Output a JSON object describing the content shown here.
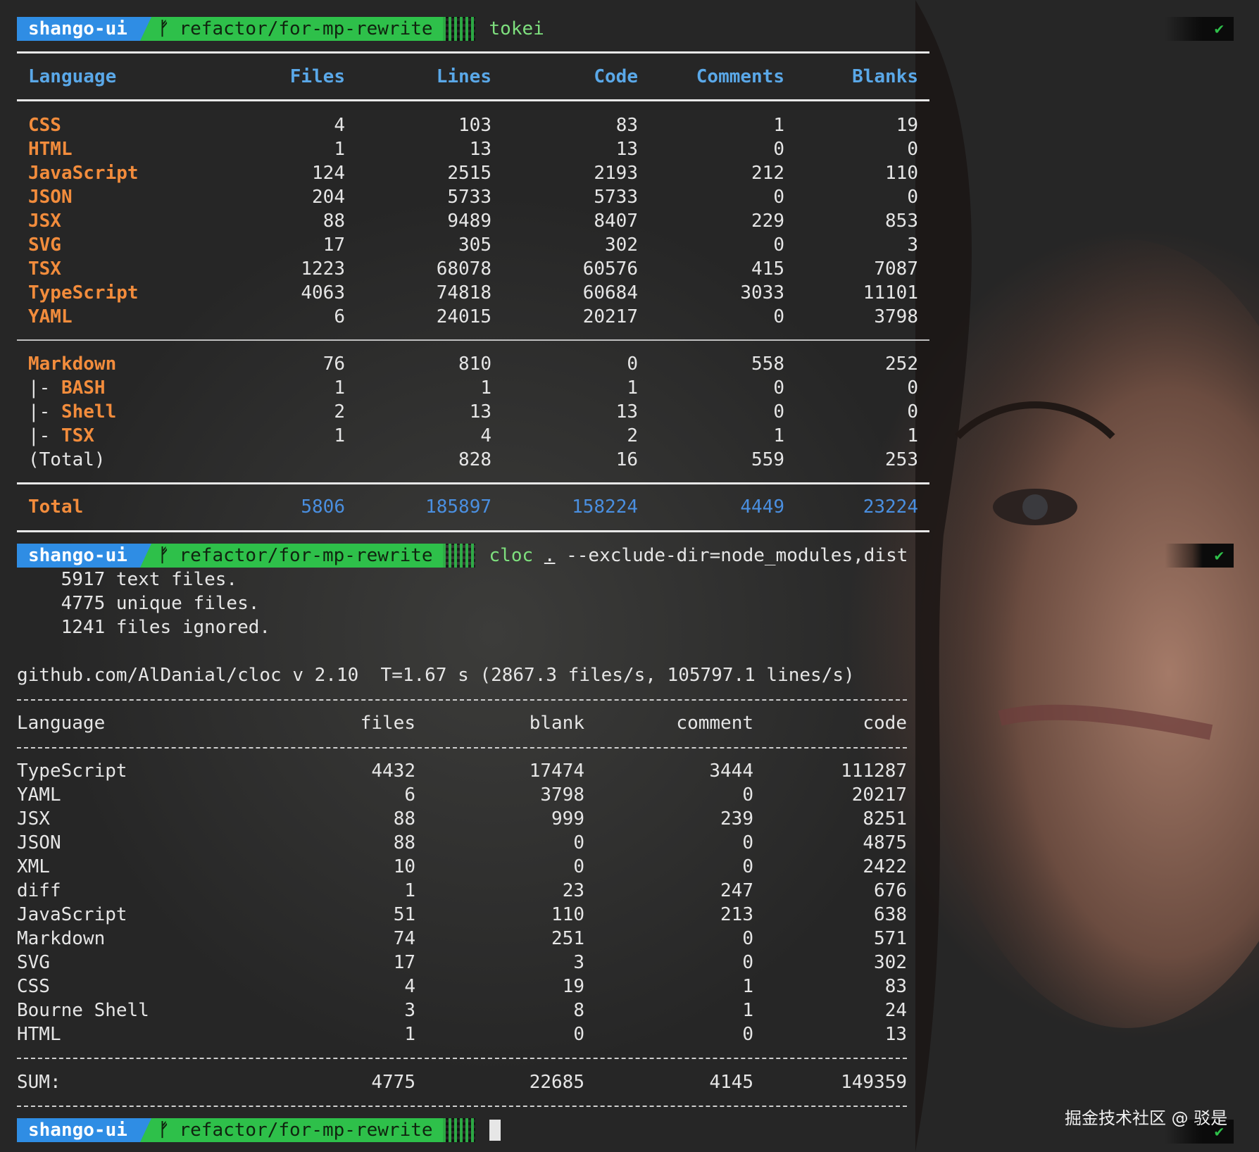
{
  "prompts": [
    {
      "user": "shango-ui",
      "git_icon": "ᚠ",
      "branch": "refactor/for-mp-rewrite",
      "command": "tokei",
      "args": "",
      "status": "✔"
    },
    {
      "user": "shango-ui",
      "git_icon": "ᚠ",
      "branch": "refactor/for-mp-rewrite",
      "command": "cloc",
      "dot": ".",
      "args": " --exclude-dir=node_modules,dist",
      "status": "✔"
    },
    {
      "user": "shango-ui",
      "git_icon": "ᚠ",
      "branch": "refactor/for-mp-rewrite",
      "command": "",
      "args": "",
      "status": "✔"
    }
  ],
  "tokei": {
    "headers": [
      "Language",
      "Files",
      "Lines",
      "Code",
      "Comments",
      "Blanks"
    ],
    "rows": [
      {
        "lang": "CSS",
        "files": "4",
        "lines": "103",
        "code": "83",
        "comments": "1",
        "blanks": "19"
      },
      {
        "lang": "HTML",
        "files": "1",
        "lines": "13",
        "code": "13",
        "comments": "0",
        "blanks": "0"
      },
      {
        "lang": "JavaScript",
        "files": "124",
        "lines": "2515",
        "code": "2193",
        "comments": "212",
        "blanks": "110"
      },
      {
        "lang": "JSON",
        "files": "204",
        "lines": "5733",
        "code": "5733",
        "comments": "0",
        "blanks": "0"
      },
      {
        "lang": "JSX",
        "files": "88",
        "lines": "9489",
        "code": "8407",
        "comments": "229",
        "blanks": "853"
      },
      {
        "lang": "SVG",
        "files": "17",
        "lines": "305",
        "code": "302",
        "comments": "0",
        "blanks": "3"
      },
      {
        "lang": "TSX",
        "files": "1223",
        "lines": "68078",
        "code": "60576",
        "comments": "415",
        "blanks": "7087"
      },
      {
        "lang": "TypeScript",
        "files": "4063",
        "lines": "74818",
        "code": "60684",
        "comments": "3033",
        "blanks": "11101"
      },
      {
        "lang": "YAML",
        "files": "6",
        "lines": "24015",
        "code": "20217",
        "comments": "0",
        "blanks": "3798"
      }
    ],
    "markdown": [
      {
        "prefix": "",
        "lang": "Markdown",
        "files": "76",
        "lines": "810",
        "code": "0",
        "comments": "558",
        "blanks": "252"
      },
      {
        "prefix": "|- ",
        "lang": "BASH",
        "files": "1",
        "lines": "1",
        "code": "1",
        "comments": "0",
        "blanks": "0"
      },
      {
        "prefix": "|- ",
        "lang": "Shell",
        "files": "2",
        "lines": "13",
        "code": "13",
        "comments": "0",
        "blanks": "0"
      },
      {
        "prefix": "|- ",
        "lang": "TSX",
        "files": "1",
        "lines": "4",
        "code": "2",
        "comments": "1",
        "blanks": "1"
      },
      {
        "prefix": "",
        "lang": "(Total)",
        "files": "",
        "lines": "828",
        "code": "16",
        "comments": "559",
        "blanks": "253"
      }
    ],
    "total": {
      "lang": "Total",
      "files": "5806",
      "lines": "185897",
      "code": "158224",
      "comments": "4449",
      "blanks": "23224"
    }
  },
  "cloc": {
    "summary": [
      "    5917 text files.",
      "    4775 unique files.",
      "    1241 files ignored."
    ],
    "version_line": "github.com/AlDanial/cloc v 2.10  T=1.67 s (2867.3 files/s, 105797.1 lines/s)",
    "headers": [
      "Language",
      "files",
      "blank",
      "comment",
      "code"
    ],
    "rows": [
      {
        "lang": "TypeScript",
        "files": "4432",
        "blank": "17474",
        "comment": "3444",
        "code": "111287"
      },
      {
        "lang": "YAML",
        "files": "6",
        "blank": "3798",
        "comment": "0",
        "code": "20217"
      },
      {
        "lang": "JSX",
        "files": "88",
        "blank": "999",
        "comment": "239",
        "code": "8251"
      },
      {
        "lang": "JSON",
        "files": "88",
        "blank": "0",
        "comment": "0",
        "code": "4875"
      },
      {
        "lang": "XML",
        "files": "10",
        "blank": "0",
        "comment": "0",
        "code": "2422"
      },
      {
        "lang": "diff",
        "files": "1",
        "blank": "23",
        "comment": "247",
        "code": "676"
      },
      {
        "lang": "JavaScript",
        "files": "51",
        "blank": "110",
        "comment": "213",
        "code": "638"
      },
      {
        "lang": "Markdown",
        "files": "74",
        "blank": "251",
        "comment": "0",
        "code": "571"
      },
      {
        "lang": "SVG",
        "files": "17",
        "blank": "3",
        "comment": "0",
        "code": "302"
      },
      {
        "lang": "CSS",
        "files": "4",
        "blank": "19",
        "comment": "1",
        "code": "83"
      },
      {
        "lang": "Bourne Shell",
        "files": "3",
        "blank": "8",
        "comment": "1",
        "code": "24"
      },
      {
        "lang": "HTML",
        "files": "1",
        "blank": "0",
        "comment": "0",
        "code": "13"
      }
    ],
    "sum": {
      "lang": "SUM:",
      "files": "4775",
      "blank": "22685",
      "comment": "4145",
      "code": "149359"
    }
  },
  "watermark": "掘金技术社区 @ 驳是",
  "colors": {
    "prompt_user_bg": "#2f8de4",
    "prompt_branch_bg": "#2ec04a",
    "header_blue": "#5aa8e8",
    "lang_orange": "#f28c3c",
    "total_blue": "#4a8fe0"
  }
}
